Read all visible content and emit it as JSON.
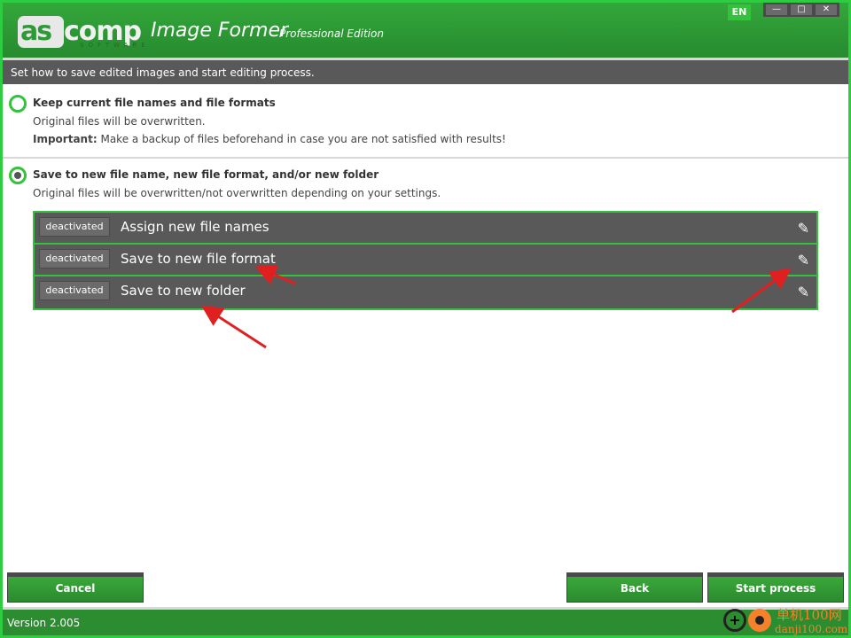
{
  "header": {
    "logo_text": "ascomp",
    "logo_sub": "SOFTWARE",
    "title": "Image Former",
    "edition": "Professional Edition",
    "language": "EN",
    "window_controls": [
      "minimize",
      "maximize",
      "close"
    ]
  },
  "instruction": "Set how to save edited images and start editing process.",
  "options": [
    {
      "title": "Keep current file names and file formats",
      "selected": false,
      "desc": "Original files will be overwritten.",
      "important_label": "Important:",
      "important_text": "Make a backup of files beforehand in case you are not satisfied with results!"
    },
    {
      "title": "Save to new file name, new file format, and/or new folder",
      "selected": true,
      "desc": "Original files will be overwritten/not overwritten depending on your settings."
    }
  ],
  "settings_rows": [
    {
      "status": "deactivated",
      "label": "Assign new file names",
      "icon": "pencil-icon"
    },
    {
      "status": "deactivated",
      "label": "Save to new file format",
      "icon": "pencil-icon"
    },
    {
      "status": "deactivated",
      "label": "Save to new folder",
      "icon": "pencil-icon"
    }
  ],
  "buttons": {
    "cancel": "Cancel",
    "back": "Back",
    "start": "Start process"
  },
  "footer": {
    "version": "Version 2.005"
  },
  "watermark": {
    "line1": "单机100网",
    "line2": "danji100.com"
  },
  "colors": {
    "accent": "#33a83a",
    "dark": "#595959",
    "annotation": "#e02020"
  }
}
